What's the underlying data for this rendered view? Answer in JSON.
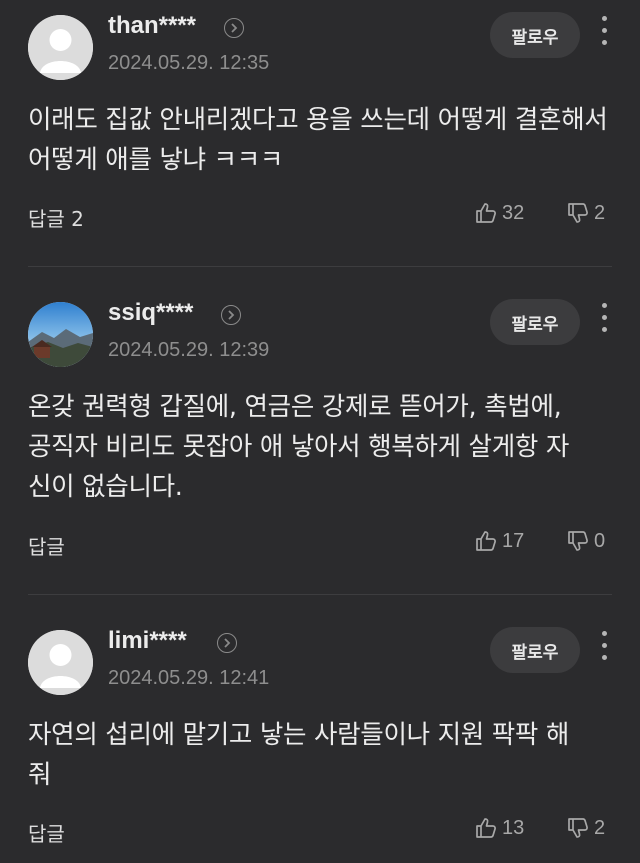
{
  "follow_label": "팔로우",
  "comments": [
    {
      "username": "than****",
      "timestamp": "2024.05.29. 12:35",
      "text": "이래도 집값 안내리겠다고 용을 쓰는데 어떻게 결혼해서 어떻게 애를 낳냐 ㅋㅋㅋ",
      "reply_label": "답글 2",
      "likes": "32",
      "dislikes": "2",
      "avatar": "default-person-icon"
    },
    {
      "username": "ssiq****",
      "timestamp": "2024.05.29. 12:39",
      "text": "온갖 권력형 갑질에, 연금은 강제로 뜯어가, 촉법에, 공직자 비리도 못잡아 애 낳아서 행복하게 살게항 자신이 없습니다.",
      "reply_label": "답글",
      "likes": "17",
      "dislikes": "0",
      "avatar": "landscape-photo"
    },
    {
      "username": "limi****",
      "timestamp": "2024.05.29. 12:41",
      "text": "자연의 섭리에 맡기고 낳는 사람들이나 지원 팍팍 해줘",
      "reply_label": "답글",
      "likes": "13",
      "dislikes": "2",
      "avatar": "default-person-icon"
    }
  ],
  "colors": {
    "background": "#2b2b2d",
    "button_bg": "#3c3c3e",
    "muted_text": "#8e8e8e",
    "divider": "#3d3d3f"
  }
}
